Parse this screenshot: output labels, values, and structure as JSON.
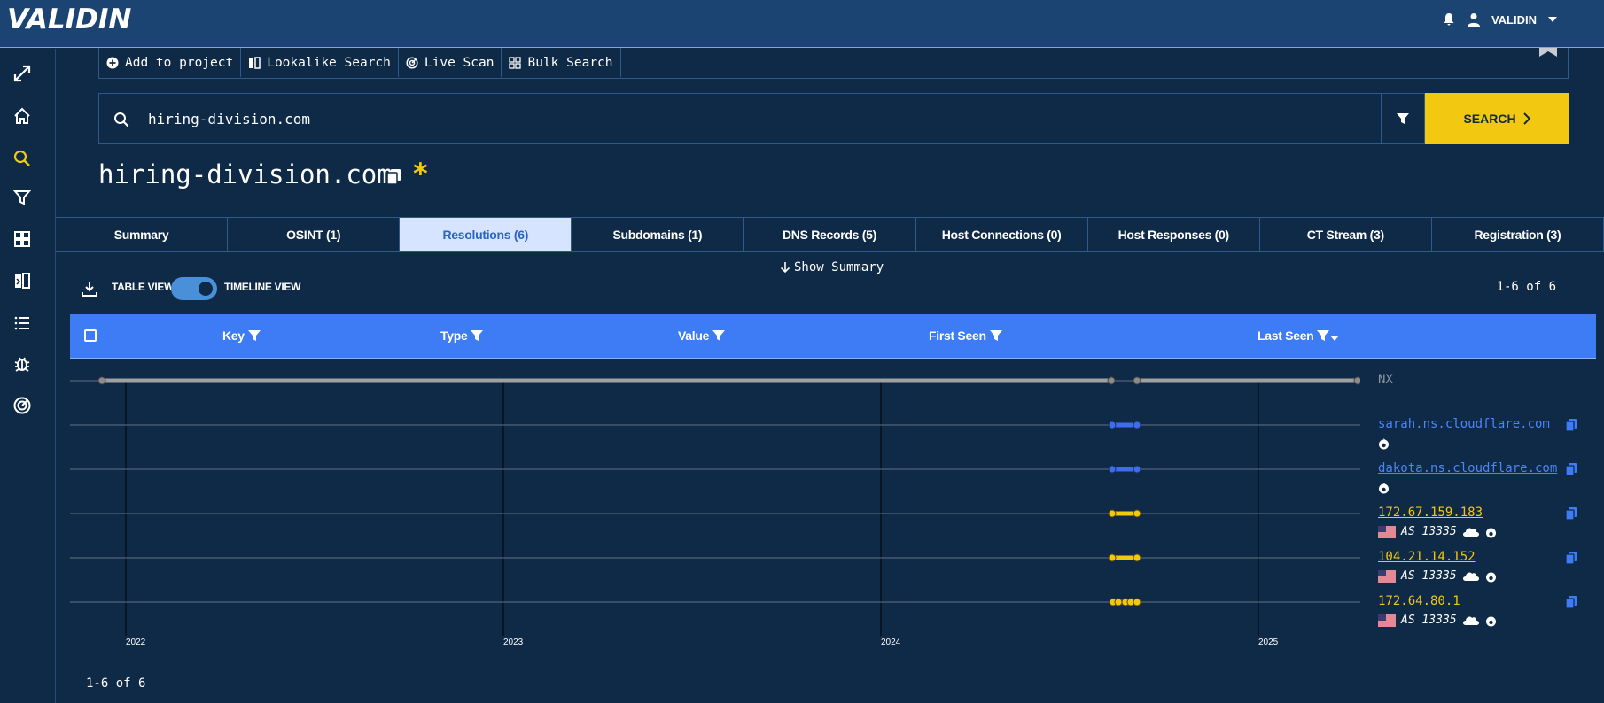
{
  "brand": {
    "logo_text": "VALIDIN"
  },
  "user": {
    "name": "VALIDIN"
  },
  "sidebar": {
    "items": [
      {
        "icon": "expand-icon"
      },
      {
        "icon": "home-icon"
      },
      {
        "icon": "search-icon",
        "active": true
      },
      {
        "icon": "filter-icon"
      },
      {
        "icon": "grid-icon"
      },
      {
        "icon": "lookalike-icon"
      },
      {
        "icon": "list-icon"
      },
      {
        "icon": "bug-icon"
      },
      {
        "icon": "target-icon"
      }
    ]
  },
  "actions": [
    {
      "label": "Add to project",
      "icon": "plus-circle-icon"
    },
    {
      "label": "Lookalike Search",
      "icon": "lookalike-icon"
    },
    {
      "label": "Live Scan",
      "icon": "radar-icon"
    },
    {
      "label": "Bulk Search",
      "icon": "grid-icon"
    }
  ],
  "search": {
    "value": "hiring-division.com",
    "button_label": "SEARCH"
  },
  "page": {
    "title": "hiring-division.com",
    "star": "*"
  },
  "tabs": [
    {
      "label": "Summary"
    },
    {
      "label": "OSINT (1)"
    },
    {
      "label": "Resolutions (6)",
      "active": true
    },
    {
      "label": "Subdomains (1)"
    },
    {
      "label": "DNS Records (5)"
    },
    {
      "label": "Host Connections (0)"
    },
    {
      "label": "Host Responses (0)"
    },
    {
      "label": "CT Stream (3)"
    },
    {
      "label": "Registration (3)"
    }
  ],
  "view": {
    "show_summary": "Show Summary",
    "table_view": "TABLE VIEW",
    "timeline_view": "TIMELINE VIEW",
    "timeline_enabled": true
  },
  "pagination": {
    "text": "1-6 of 6"
  },
  "table": {
    "columns": [
      "Key",
      "Type",
      "Value",
      "First Seen",
      "Last Seen"
    ]
  },
  "timeline": {
    "years": [
      "2022",
      "2023",
      "2024",
      "2025"
    ],
    "rows": [
      {
        "label": "NX",
        "kind": "nx"
      },
      {
        "label": "sarah.ns.cloudflare.com",
        "kind": "ns"
      },
      {
        "label": "dakota.ns.cloudflare.com",
        "kind": "ns"
      },
      {
        "label": "172.67.159.183",
        "kind": "ip",
        "asn": "AS 13335"
      },
      {
        "label": "104.21.14.152",
        "kind": "ip",
        "asn": "AS 13335"
      },
      {
        "label": "172.64.80.1",
        "kind": "ip",
        "asn": "AS 13335"
      }
    ]
  },
  "colors": {
    "accent": "#f2c811",
    "header": "#3d7cf5",
    "ns_bar": "#3d6cf0",
    "ip_bar": "#f2c811",
    "nx_bar": "#8c8c8c",
    "bg": "#0f2a47"
  }
}
